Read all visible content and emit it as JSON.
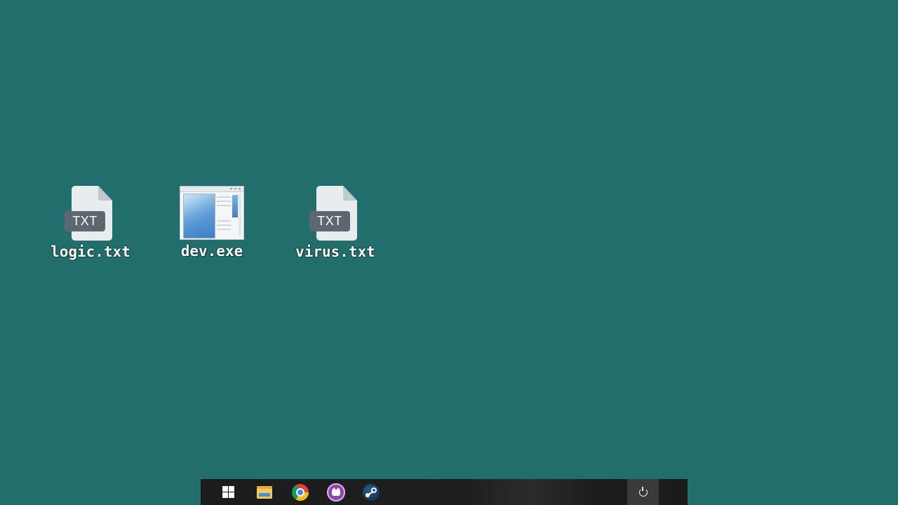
{
  "desktop": {
    "background_color": "#216e6d",
    "icons": [
      {
        "label": "logic.txt",
        "type": "text-file",
        "badge": "TXT"
      },
      {
        "label": "dev.exe",
        "type": "executable"
      },
      {
        "label": "virus.txt",
        "type": "text-file",
        "badge": "TXT"
      }
    ]
  },
  "taskbar": {
    "background_color": "#1c1c1c",
    "items": [
      {
        "name": "start",
        "icon": "windows-logo-icon"
      },
      {
        "name": "file-explorer",
        "icon": "folder-icon"
      },
      {
        "name": "chrome",
        "icon": "chrome-icon"
      },
      {
        "name": "cat-app",
        "icon": "cat-icon"
      },
      {
        "name": "steam",
        "icon": "steam-icon"
      }
    ],
    "power": {
      "icon": "power-icon"
    }
  }
}
